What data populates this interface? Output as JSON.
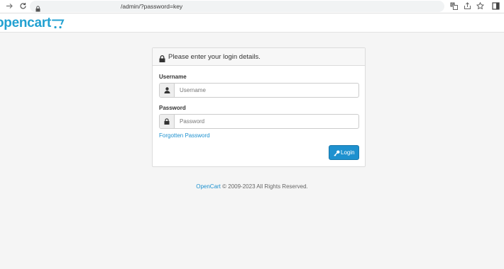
{
  "browser": {
    "url": "/admin/?password=key"
  },
  "header": {
    "logo_text": "opencart"
  },
  "login": {
    "heading": "Please enter your login details.",
    "username_label": "Username",
    "username_placeholder": "Username",
    "password_label": "Password",
    "password_placeholder": "Password",
    "forgot_link": "Forgotten Password",
    "login_button": "Login"
  },
  "footer": {
    "link_text": "OpenCart",
    "copyright": "© 2009-2023 All Rights Reserved."
  },
  "colors": {
    "brand": "#23a1d1",
    "link": "#1e91cf",
    "button": "#1e91cf"
  }
}
